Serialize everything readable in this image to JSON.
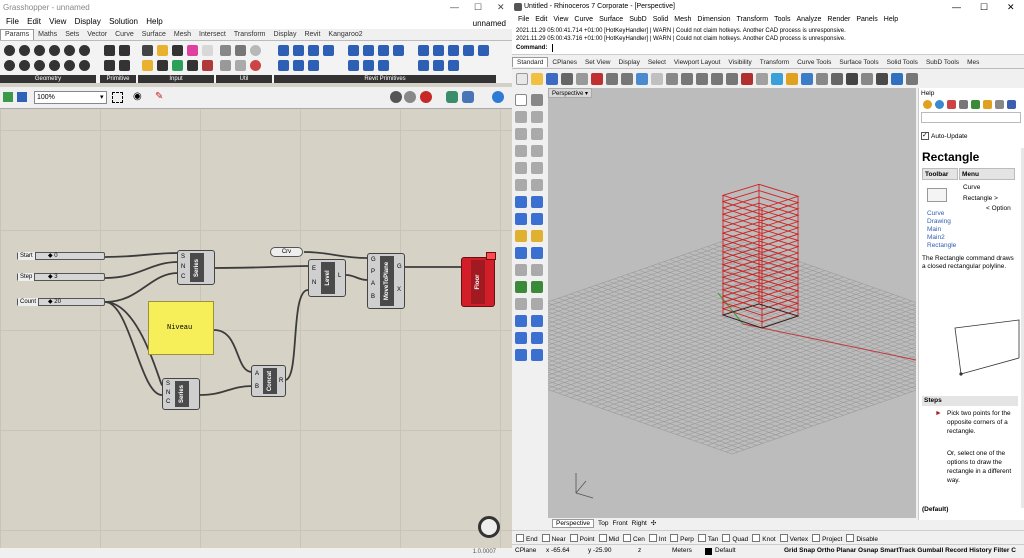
{
  "gh": {
    "title": "Grasshopper - unnamed",
    "doc_name": "unnamed",
    "menu": [
      "File",
      "Edit",
      "View",
      "Display",
      "Solution",
      "Help"
    ],
    "tabs": [
      "Params",
      "Maths",
      "Sets",
      "Vector",
      "Curve",
      "Surface",
      "Mesh",
      "Intersect",
      "Transform",
      "Display",
      "Revit",
      "Kangaroo2"
    ],
    "ribbon_groups": [
      "Geometry",
      "Primitive",
      "Input",
      "Util",
      "Revit Primitives"
    ],
    "zoom": "100%",
    "status": "1.0.0007",
    "sliders": [
      {
        "label": "Start",
        "value": "◆ 0"
      },
      {
        "label": "Step",
        "value": "◆ 3"
      },
      {
        "label": "Count",
        "value": "◆ 20"
      }
    ],
    "components": {
      "series": "Series",
      "series2": "Series",
      "level": "Level",
      "move": "MoveToPlane",
      "concat": "Concat",
      "floor": "Floor",
      "crv": "Crv"
    },
    "ports": {
      "series_in": [
        "S",
        "N",
        "C"
      ],
      "level_in": [
        "E",
        "N"
      ],
      "level_out": [
        "L"
      ],
      "move_in": [
        "G",
        "P",
        "A",
        "B"
      ],
      "move_out": [
        "G",
        "X"
      ],
      "concat_in": [
        "A",
        "B"
      ],
      "concat_out": [
        "R"
      ]
    },
    "panel": "Niveau"
  },
  "rh": {
    "title": "Untitled - Rhinoceros 7 Corporate - [Perspective]",
    "menu": [
      "File",
      "Edit",
      "View",
      "Curve",
      "Surface",
      "SubD",
      "Solid",
      "Mesh",
      "Dimension",
      "Transform",
      "Tools",
      "Analyze",
      "Render",
      "Panels",
      "Help"
    ],
    "history": [
      "2021.11.29 05:00:41.714 +01:00 [HotKeyHandler] | WARN | Could not claim hotkeys. Another CAD process is unresponsive.",
      "2021.11.29 05:00:43.716 +01:00 [HotKeyHandler] | WARN | Could not claim hotkeys. Another CAD process is unresponsive."
    ],
    "command_label": "Command:",
    "tabs": [
      "Standard",
      "CPlanes",
      "Set View",
      "Display",
      "Select",
      "Viewport Layout",
      "Visibility",
      "Transform",
      "Curve Tools",
      "Surface Tools",
      "Solid Tools",
      "SubD Tools",
      "Mes"
    ],
    "viewport": "Perspective",
    "viewport_tabs": [
      "Perspective",
      "Top",
      "Front",
      "Right",
      "✣"
    ],
    "help": {
      "title": "Help",
      "auto_update": "Auto-Update",
      "heading": "Rectangle",
      "col_toolbar": "Toolbar",
      "col_menu": "Menu",
      "menu_path": [
        "Curve",
        "Rectangle >",
        "< Option"
      ],
      "toolbar_links": [
        "Curve",
        "Drawing",
        "Main",
        "Main2",
        "Rectangle"
      ],
      "desc": "The Rectangle command draws a closed rectangular polyline.",
      "steps_title": "Steps",
      "step1": "Pick two points for the opposite corners of a rectangle.",
      "step2": "Or, select one of the options to draw the rectangle in a different way.",
      "default": "(Default)"
    },
    "osnap": [
      "End",
      "Near",
      "Point",
      "Mid",
      "Cen",
      "Int",
      "Perp",
      "Tan",
      "Quad",
      "Knot",
      "Vertex",
      "Project",
      "Disable"
    ],
    "status": {
      "cplane": "CPlane",
      "x": "x -65.64",
      "y": "y -25.90",
      "z": "z",
      "units": "Meters",
      "layer": "Default",
      "items": "Grid Snap  Ortho  Planar  Osnap  SmartTrack  Gumball  Record History  Filter  C"
    }
  },
  "colors": {
    "panel": "#f7ef5a",
    "floor": "#d21e28",
    "grid_red": "#c0383c"
  }
}
